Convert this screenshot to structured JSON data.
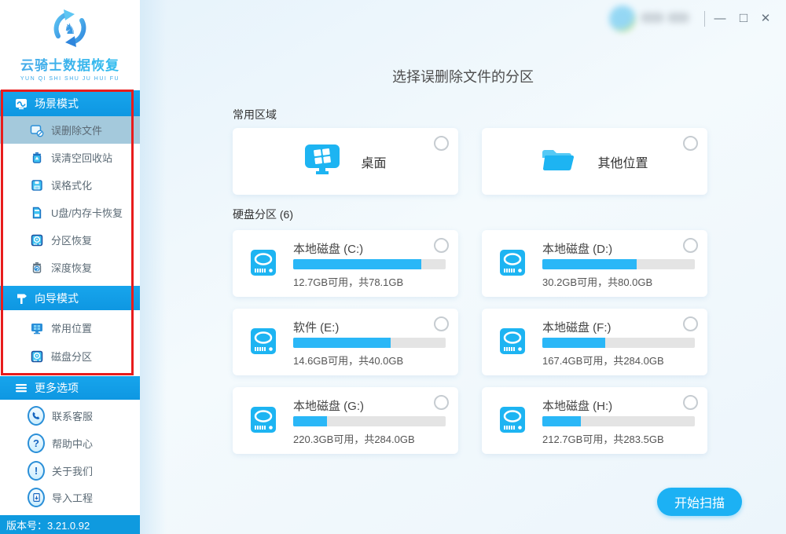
{
  "colors": {
    "accent": "#1db4f2",
    "sidebar_header_blue": "#119ee8",
    "selected_item_bg": "#a4c9dc",
    "progress_fill": "#2ab7f7",
    "progress_track": "#e4e4e4",
    "annotation_red": "#e81c1c",
    "version_bar_blue": "#0f9adf"
  },
  "window": {
    "minimize": "—",
    "maximize": "□",
    "close": "✕"
  },
  "sidebar": {
    "logo": {
      "title": "云骑士数据恢复",
      "subtitle": "YUN QI SHI SHU JU HUI FU",
      "icon": "circular-arrows-knight-logo"
    },
    "sections": [
      {
        "label": "场景模式",
        "icon": "scene-mode-icon",
        "items": [
          {
            "label": "误删除文件",
            "icon": "deleted-file-icon",
            "selected": true
          },
          {
            "label": "误清空回收站",
            "icon": "recycle-bin-icon"
          },
          {
            "label": "误格式化",
            "icon": "floppy-icon"
          },
          {
            "label": "U盘/内存卡恢复",
            "icon": "memory-card-icon"
          },
          {
            "label": "分区恢复",
            "icon": "partition-disk-icon"
          },
          {
            "label": "深度恢复",
            "icon": "deep-recovery-icon"
          }
        ]
      },
      {
        "label": "向导模式",
        "icon": "signpost-icon",
        "items": [
          {
            "label": "常用位置",
            "icon": "monitor-icon"
          },
          {
            "label": "磁盘分区",
            "icon": "disk-icon"
          }
        ]
      },
      {
        "label": "更多选项",
        "icon": "hamburger-icon",
        "items": [
          {
            "label": "联系客服",
            "icon": "phone-icon"
          },
          {
            "label": "帮助中心",
            "icon": "question-icon"
          },
          {
            "label": "关于我们",
            "icon": "exclamation-icon"
          },
          {
            "label": "导入工程",
            "icon": "import-icon"
          }
        ]
      }
    ],
    "version": "版本号：3.21.0.92"
  },
  "main": {
    "title": "选择误删除文件的分区",
    "common_area": {
      "label": "常用区域",
      "cards": [
        {
          "label": "桌面",
          "icon": "desktop-icon"
        },
        {
          "label": "其他位置",
          "icon": "folder-icon"
        }
      ]
    },
    "partitions": {
      "label": "硬盘分区 (6)",
      "disks": [
        {
          "name": "本地磁盘 (C:)",
          "info": "12.7GB可用，共78.1GB",
          "used_percent": 84
        },
        {
          "name": "本地磁盘 (D:)",
          "info": "30.2GB可用，共80.0GB",
          "used_percent": 62
        },
        {
          "name": "软件 (E:)",
          "info": "14.6GB可用，共40.0GB",
          "used_percent": 64
        },
        {
          "name": "本地磁盘 (F:)",
          "info": "167.4GB可用，共284.0GB",
          "used_percent": 41
        },
        {
          "name": "本地磁盘 (G:)",
          "info": "220.3GB可用，共284.0GB",
          "used_percent": 22
        },
        {
          "name": "本地磁盘 (H:)",
          "info": "212.7GB可用，共283.5GB",
          "used_percent": 25
        }
      ]
    },
    "scan_button": "开始扫描"
  }
}
